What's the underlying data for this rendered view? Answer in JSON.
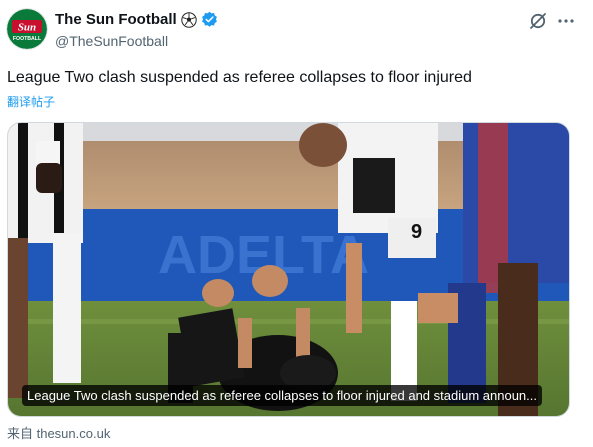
{
  "account": {
    "display_name": "The Sun Football",
    "handle": "@TheSunFootball",
    "avatar_text_top": "Sun",
    "avatar_text_bottom": "FOOTBALL",
    "verified": true,
    "name_emoji": "soccer-ball-icon"
  },
  "tweet": {
    "text": "League Two clash suspended as referee collapses to floor injured",
    "translate_label": "翻译帖子"
  },
  "card": {
    "caption": "League Two clash suspended as referee collapses to floor injured and stadium announ...",
    "ad_board_text": "ADELTA",
    "source_label": "来自 thesun.co.uk"
  },
  "colors": {
    "accent": "#1d9bf0",
    "text_primary": "#0f1419",
    "text_secondary": "#536471",
    "sun_red": "#c8102e",
    "sun_green": "#0a7a3a"
  }
}
